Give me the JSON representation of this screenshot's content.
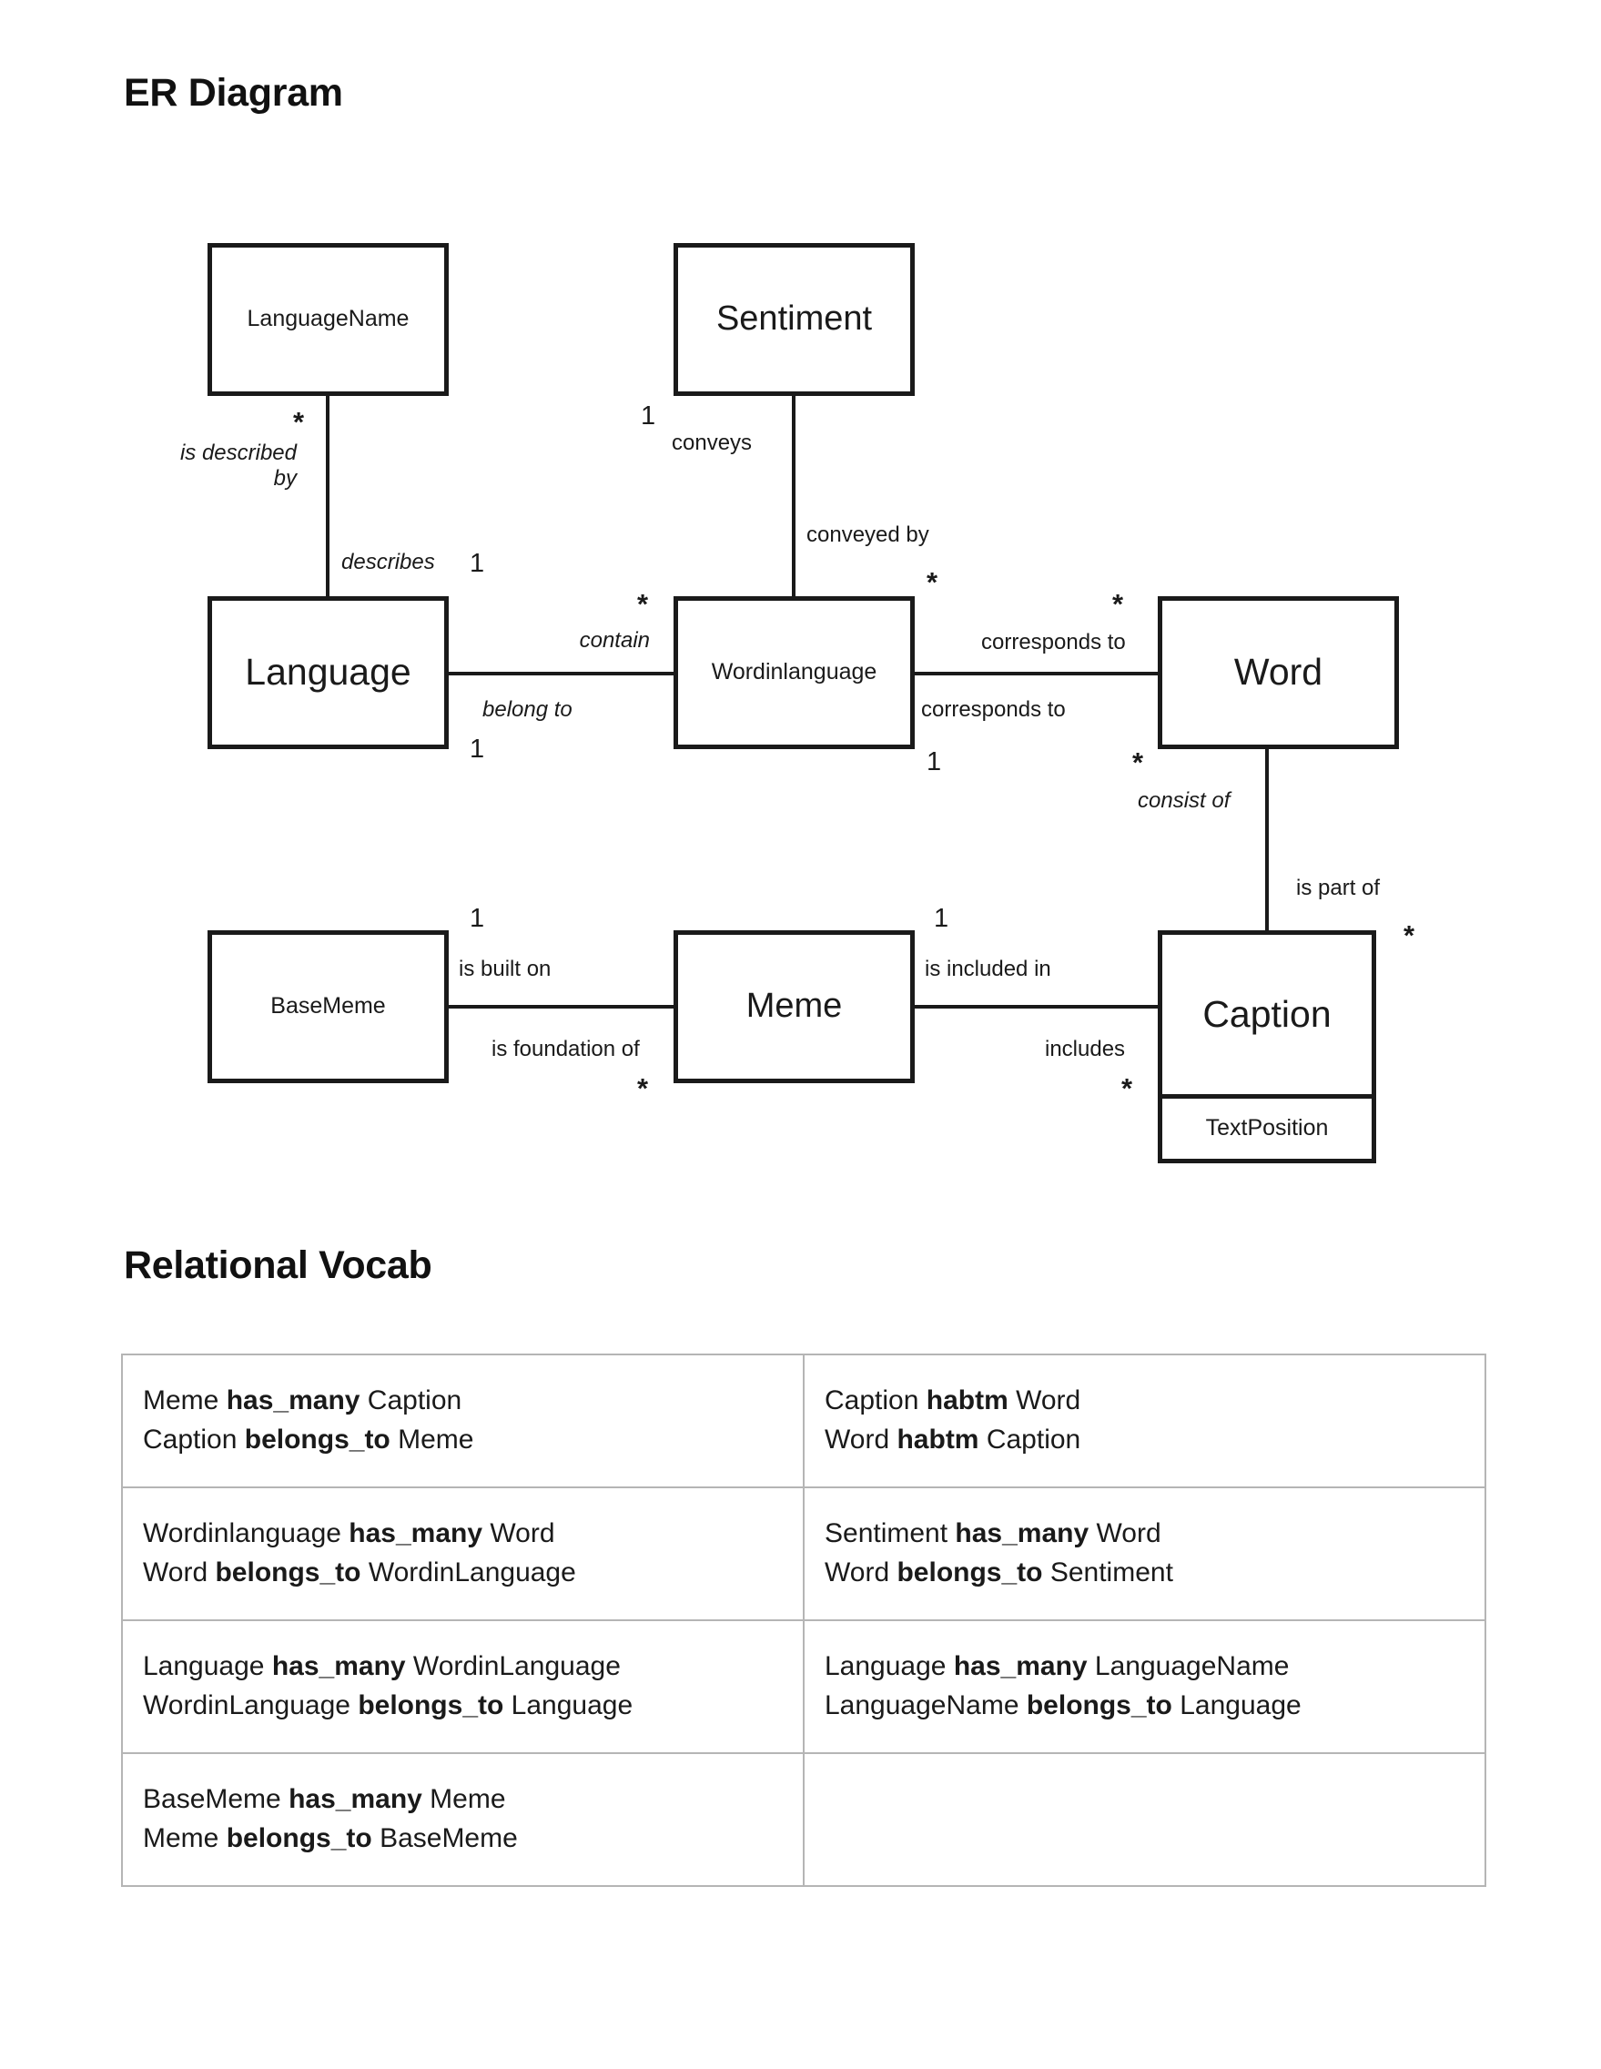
{
  "sections": {
    "er_title": "ER Diagram",
    "vocab_title": "Relational Vocab"
  },
  "diagram": {
    "entities": [
      {
        "id": "languagename",
        "name": "LanguageName"
      },
      {
        "id": "sentiment",
        "name": "Sentiment"
      },
      {
        "id": "language",
        "name": "Language"
      },
      {
        "id": "wordinlanguage",
        "name": "Wordinlanguage"
      },
      {
        "id": "word",
        "name": "Word"
      },
      {
        "id": "basememe",
        "name": "BaseMeme"
      },
      {
        "id": "meme",
        "name": "Meme"
      },
      {
        "id": "caption",
        "name": "Caption",
        "attribute": "TextPosition"
      }
    ],
    "annotations": {
      "ln_star": "*",
      "ln_is_described_by": "is described\nby",
      "ln_describes": "describes",
      "ln_one": "1",
      "sent_one": "1",
      "sent_conveys": "conveys",
      "sent_conveyed_by": "conveyed by",
      "wil_top_star": "*",
      "lang_contain_star": "*",
      "lang_contain": "contain",
      "lang_belong_to": "belong to",
      "lang_belong_one": "1",
      "wil_corr_star": "*",
      "corresponds_to_top": "corresponds to",
      "corresponds_to_bottom": "corresponds to",
      "wil_corr_one": "1",
      "word_corr_star": "*",
      "word_consist_star": "*",
      "word_consist_of": "consist of",
      "cap_is_part_of": "is part of",
      "cap_part_star": "*",
      "bm_one": "1",
      "bm_is_built_on": "is built on",
      "bm_is_foundation_of": "is foundation of",
      "meme_found_star": "*",
      "meme_one": "1",
      "meme_is_included_in": "is included in",
      "meme_includes": "includes",
      "cap_inc_star": "*"
    }
  },
  "vocab": {
    "rows": [
      {
        "left": [
          {
            "a": "Meme",
            "kw": "has_many",
            "b": "Caption"
          },
          {
            "a": "Caption",
            "kw": "belongs_to",
            "b": "Meme"
          }
        ],
        "right": [
          {
            "a": "Caption",
            "kw": "habtm",
            "b": "Word"
          },
          {
            "a": "Word",
            "kw": "habtm",
            "b": "Caption"
          }
        ]
      },
      {
        "left": [
          {
            "a": "Wordinlanguage",
            "kw": "has_many",
            "b": "Word"
          },
          {
            "a": "Word",
            "kw": "belongs_to",
            "b": "WordinLanguage"
          }
        ],
        "right": [
          {
            "a": "Sentiment",
            "kw": "has_many",
            "b": "Word"
          },
          {
            "a": "Word",
            "kw": "belongs_to",
            "b": "Sentiment"
          }
        ]
      },
      {
        "left": [
          {
            "a": "Language",
            "kw": "has_many",
            "b": "WordinLanguage"
          },
          {
            "a": "WordinLanguage",
            "kw": "belongs_to",
            "b": "Language"
          }
        ],
        "right": [
          {
            "a": "Language",
            "kw": "has_many",
            "b": "LanguageName"
          },
          {
            "a": "LanguageName",
            "kw": "belongs_to",
            "b": "Language"
          }
        ]
      },
      {
        "left": [
          {
            "a": "BaseMeme",
            "kw": "has_many",
            "b": "Meme"
          },
          {
            "a": "Meme",
            "kw": "belongs_to",
            "b": "BaseMeme"
          }
        ],
        "right": []
      }
    ]
  },
  "colors": {
    "ink": "#1a1a1a",
    "table_border": "#b5b5b5",
    "background": "#ffffff"
  }
}
